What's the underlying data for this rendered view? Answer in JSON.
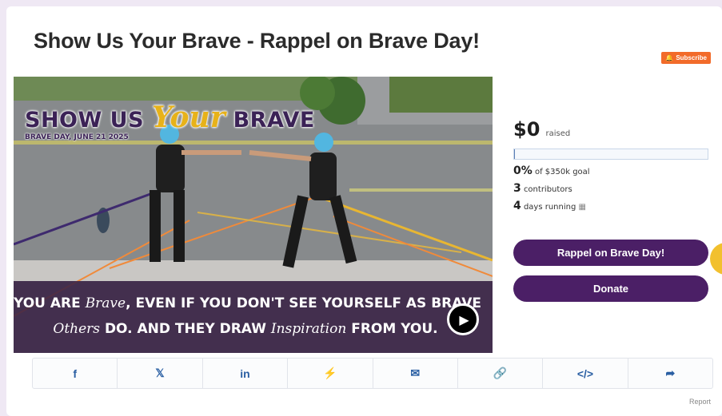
{
  "page": {
    "title": "Show Us Your Brave - Rappel on Brave Day!"
  },
  "subscribe": {
    "label": "Subscribe"
  },
  "media": {
    "hero_title_1": "SHOW US",
    "hero_title_script": "Your",
    "hero_title_2": "BRAVE",
    "hero_date": "BRAVE DAY, JUNE 21 2025",
    "banner_line1_a": "YOU ARE",
    "banner_line1_script": "Brave",
    "banner_line1_b": ", EVEN IF YOU DON'T SEE YOURSELF AS BRAVE",
    "banner_line2_script_a": "Others",
    "banner_line2_a": " DO. AND THEY DRAW ",
    "banner_line2_script_b": "Inspiration",
    "banner_line2_b": " FROM YOU."
  },
  "stats": {
    "raised_amount": "$0",
    "raised_label": "raised",
    "progress_fraction": 0.0,
    "percent": "0%",
    "goal_text": "of $350k goal",
    "contributors_count": "3",
    "contributors_label": "contributors",
    "days_count": "4",
    "days_label": "days running"
  },
  "actions": {
    "rappel_label": "Rappel on Brave Day!",
    "donate_label": "Donate"
  },
  "share": {
    "items": [
      {
        "name": "facebook",
        "glyph": "f"
      },
      {
        "name": "x",
        "glyph": "𝕏"
      },
      {
        "name": "linkedin",
        "glyph": "in"
      },
      {
        "name": "messenger",
        "glyph": "⚡"
      },
      {
        "name": "email",
        "glyph": "✉"
      },
      {
        "name": "link",
        "glyph": "🔗"
      },
      {
        "name": "embed",
        "glyph": "</>"
      },
      {
        "name": "share",
        "glyph": "➦"
      }
    ]
  },
  "footer": {
    "report_label": "Report"
  },
  "colors": {
    "accent": "#4b1f66",
    "subscribe": "#f26b2a",
    "share_icon": "#2a5fa3"
  }
}
